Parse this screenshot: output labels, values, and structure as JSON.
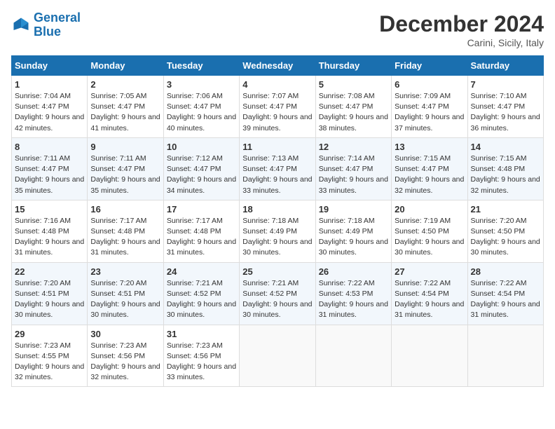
{
  "header": {
    "logo_line1": "General",
    "logo_line2": "Blue",
    "month_title": "December 2024",
    "location": "Carini, Sicily, Italy"
  },
  "weekdays": [
    "Sunday",
    "Monday",
    "Tuesday",
    "Wednesday",
    "Thursday",
    "Friday",
    "Saturday"
  ],
  "weeks": [
    [
      {
        "day": "1",
        "sunrise": "Sunrise: 7:04 AM",
        "sunset": "Sunset: 4:47 PM",
        "daylight": "Daylight: 9 hours and 42 minutes."
      },
      {
        "day": "2",
        "sunrise": "Sunrise: 7:05 AM",
        "sunset": "Sunset: 4:47 PM",
        "daylight": "Daylight: 9 hours and 41 minutes."
      },
      {
        "day": "3",
        "sunrise": "Sunrise: 7:06 AM",
        "sunset": "Sunset: 4:47 PM",
        "daylight": "Daylight: 9 hours and 40 minutes."
      },
      {
        "day": "4",
        "sunrise": "Sunrise: 7:07 AM",
        "sunset": "Sunset: 4:47 PM",
        "daylight": "Daylight: 9 hours and 39 minutes."
      },
      {
        "day": "5",
        "sunrise": "Sunrise: 7:08 AM",
        "sunset": "Sunset: 4:47 PM",
        "daylight": "Daylight: 9 hours and 38 minutes."
      },
      {
        "day": "6",
        "sunrise": "Sunrise: 7:09 AM",
        "sunset": "Sunset: 4:47 PM",
        "daylight": "Daylight: 9 hours and 37 minutes."
      },
      {
        "day": "7",
        "sunrise": "Sunrise: 7:10 AM",
        "sunset": "Sunset: 4:47 PM",
        "daylight": "Daylight: 9 hours and 36 minutes."
      }
    ],
    [
      {
        "day": "8",
        "sunrise": "Sunrise: 7:11 AM",
        "sunset": "Sunset: 4:47 PM",
        "daylight": "Daylight: 9 hours and 35 minutes."
      },
      {
        "day": "9",
        "sunrise": "Sunrise: 7:11 AM",
        "sunset": "Sunset: 4:47 PM",
        "daylight": "Daylight: 9 hours and 35 minutes."
      },
      {
        "day": "10",
        "sunrise": "Sunrise: 7:12 AM",
        "sunset": "Sunset: 4:47 PM",
        "daylight": "Daylight: 9 hours and 34 minutes."
      },
      {
        "day": "11",
        "sunrise": "Sunrise: 7:13 AM",
        "sunset": "Sunset: 4:47 PM",
        "daylight": "Daylight: 9 hours and 33 minutes."
      },
      {
        "day": "12",
        "sunrise": "Sunrise: 7:14 AM",
        "sunset": "Sunset: 4:47 PM",
        "daylight": "Daylight: 9 hours and 33 minutes."
      },
      {
        "day": "13",
        "sunrise": "Sunrise: 7:15 AM",
        "sunset": "Sunset: 4:47 PM",
        "daylight": "Daylight: 9 hours and 32 minutes."
      },
      {
        "day": "14",
        "sunrise": "Sunrise: 7:15 AM",
        "sunset": "Sunset: 4:48 PM",
        "daylight": "Daylight: 9 hours and 32 minutes."
      }
    ],
    [
      {
        "day": "15",
        "sunrise": "Sunrise: 7:16 AM",
        "sunset": "Sunset: 4:48 PM",
        "daylight": "Daylight: 9 hours and 31 minutes."
      },
      {
        "day": "16",
        "sunrise": "Sunrise: 7:17 AM",
        "sunset": "Sunset: 4:48 PM",
        "daylight": "Daylight: 9 hours and 31 minutes."
      },
      {
        "day": "17",
        "sunrise": "Sunrise: 7:17 AM",
        "sunset": "Sunset: 4:48 PM",
        "daylight": "Daylight: 9 hours and 31 minutes."
      },
      {
        "day": "18",
        "sunrise": "Sunrise: 7:18 AM",
        "sunset": "Sunset: 4:49 PM",
        "daylight": "Daylight: 9 hours and 30 minutes."
      },
      {
        "day": "19",
        "sunrise": "Sunrise: 7:18 AM",
        "sunset": "Sunset: 4:49 PM",
        "daylight": "Daylight: 9 hours and 30 minutes."
      },
      {
        "day": "20",
        "sunrise": "Sunrise: 7:19 AM",
        "sunset": "Sunset: 4:50 PM",
        "daylight": "Daylight: 9 hours and 30 minutes."
      },
      {
        "day": "21",
        "sunrise": "Sunrise: 7:20 AM",
        "sunset": "Sunset: 4:50 PM",
        "daylight": "Daylight: 9 hours and 30 minutes."
      }
    ],
    [
      {
        "day": "22",
        "sunrise": "Sunrise: 7:20 AM",
        "sunset": "Sunset: 4:51 PM",
        "daylight": "Daylight: 9 hours and 30 minutes."
      },
      {
        "day": "23",
        "sunrise": "Sunrise: 7:20 AM",
        "sunset": "Sunset: 4:51 PM",
        "daylight": "Daylight: 9 hours and 30 minutes."
      },
      {
        "day": "24",
        "sunrise": "Sunrise: 7:21 AM",
        "sunset": "Sunset: 4:52 PM",
        "daylight": "Daylight: 9 hours and 30 minutes."
      },
      {
        "day": "25",
        "sunrise": "Sunrise: 7:21 AM",
        "sunset": "Sunset: 4:52 PM",
        "daylight": "Daylight: 9 hours and 30 minutes."
      },
      {
        "day": "26",
        "sunrise": "Sunrise: 7:22 AM",
        "sunset": "Sunset: 4:53 PM",
        "daylight": "Daylight: 9 hours and 31 minutes."
      },
      {
        "day": "27",
        "sunrise": "Sunrise: 7:22 AM",
        "sunset": "Sunset: 4:54 PM",
        "daylight": "Daylight: 9 hours and 31 minutes."
      },
      {
        "day": "28",
        "sunrise": "Sunrise: 7:22 AM",
        "sunset": "Sunset: 4:54 PM",
        "daylight": "Daylight: 9 hours and 31 minutes."
      }
    ],
    [
      {
        "day": "29",
        "sunrise": "Sunrise: 7:23 AM",
        "sunset": "Sunset: 4:55 PM",
        "daylight": "Daylight: 9 hours and 32 minutes."
      },
      {
        "day": "30",
        "sunrise": "Sunrise: 7:23 AM",
        "sunset": "Sunset: 4:56 PM",
        "daylight": "Daylight: 9 hours and 32 minutes."
      },
      {
        "day": "31",
        "sunrise": "Sunrise: 7:23 AM",
        "sunset": "Sunset: 4:56 PM",
        "daylight": "Daylight: 9 hours and 33 minutes."
      },
      null,
      null,
      null,
      null
    ]
  ]
}
